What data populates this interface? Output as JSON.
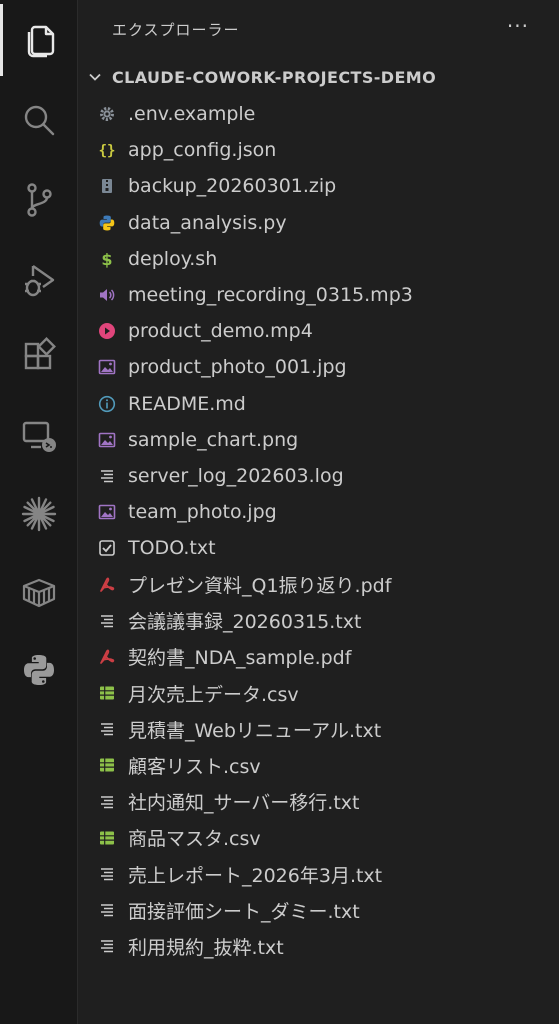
{
  "activity_bar": {
    "items": [
      {
        "icon": "explorer-icon",
        "active": true
      },
      {
        "icon": "search-icon"
      },
      {
        "icon": "source-control-icon"
      },
      {
        "icon": "run-debug-icon"
      },
      {
        "icon": "extensions-icon"
      },
      {
        "icon": "remote-explorer-icon"
      },
      {
        "icon": "claude-icon"
      },
      {
        "icon": "container-icon"
      },
      {
        "icon": "python-icon"
      }
    ]
  },
  "sidebar": {
    "title": "エクスプローラー",
    "more_label": "···",
    "folder": {
      "name": "CLAUDE-COWORK-PROJECTS-DEMO",
      "expanded": true
    },
    "files": [
      {
        "name": ".env.example",
        "icon": "gear-icon",
        "color": "#8a9199"
      },
      {
        "name": "app_config.json",
        "icon": "json-braces-icon",
        "color": "#cbcb41"
      },
      {
        "name": "backup_20260301.zip",
        "icon": "zip-icon",
        "color": "#7a8794"
      },
      {
        "name": "data_analysis.py",
        "icon": "python-file-icon",
        "color": "#4b8bbe"
      },
      {
        "name": "deploy.sh",
        "icon": "dollar-icon",
        "color": "#8dc149"
      },
      {
        "name": "meeting_recording_0315.mp3",
        "icon": "audio-icon",
        "color": "#a074c4"
      },
      {
        "name": "product_demo.mp4",
        "icon": "video-icon",
        "color": "#e0457b"
      },
      {
        "name": "product_photo_001.jpg",
        "icon": "image-icon",
        "color": "#a074c4"
      },
      {
        "name": "README.md",
        "icon": "info-icon",
        "color": "#519aba"
      },
      {
        "name": "sample_chart.png",
        "icon": "image-icon",
        "color": "#a074c4"
      },
      {
        "name": "server_log_202603.log",
        "icon": "lines-icon",
        "color": "#cccccc"
      },
      {
        "name": "team_photo.jpg",
        "icon": "image-icon",
        "color": "#a074c4"
      },
      {
        "name": "TODO.txt",
        "icon": "checkbox-icon",
        "color": "#cccccc"
      },
      {
        "name": "プレゼン資料_Q1振り返り.pdf",
        "icon": "pdf-icon",
        "color": "#cc3e44"
      },
      {
        "name": "会議議事録_20260315.txt",
        "icon": "lines-icon",
        "color": "#cccccc"
      },
      {
        "name": "契約書_NDA_sample.pdf",
        "icon": "pdf-icon",
        "color": "#cc3e44"
      },
      {
        "name": "月次売上データ.csv",
        "icon": "csv-icon",
        "color": "#8dc149"
      },
      {
        "name": "見積書_Webリニューアル.txt",
        "icon": "lines-icon",
        "color": "#cccccc"
      },
      {
        "name": "顧客リスト.csv",
        "icon": "csv-icon",
        "color": "#8dc149"
      },
      {
        "name": "社内通知_サーバー移行.txt",
        "icon": "lines-icon",
        "color": "#cccccc"
      },
      {
        "name": "商品マスタ.csv",
        "icon": "csv-icon",
        "color": "#8dc149"
      },
      {
        "name": "売上レポート_2026年3月.txt",
        "icon": "lines-icon",
        "color": "#cccccc"
      },
      {
        "name": "面接評価シート_ダミー.txt",
        "icon": "lines-icon",
        "color": "#cccccc"
      },
      {
        "name": "利用規約_抜粋.txt",
        "icon": "lines-icon",
        "color": "#cccccc"
      }
    ]
  }
}
